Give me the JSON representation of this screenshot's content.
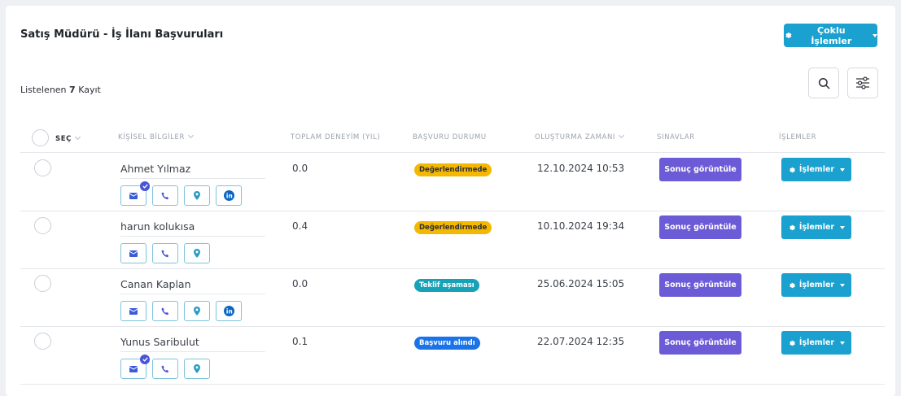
{
  "page": {
    "title": "Satış Müdürü - İş İlanı Başvuruları",
    "bulk_button": "Çoklu İşlemler",
    "count_prefix": "Listelenen",
    "count_value": "7",
    "count_suffix": "Kayıt",
    "search_icon": "search-icon",
    "filter_icon": "filter-sliders-icon"
  },
  "table": {
    "headers": {
      "select": "SEÇ",
      "personal": "KİŞİSEL BİLGİLER",
      "experience": "TOPLAM DENEYİM (YIL)",
      "status": "BAŞVURU DURUMU",
      "created": "OLUŞTURMA ZAMANI",
      "exams": "SINAVLAR",
      "actions": "İŞLEMLER"
    },
    "rows": [
      {
        "name": "Ahmet Yılmaz",
        "experience": "0.0",
        "status": "Değerlendirmede",
        "status_color": "#f5b800",
        "created": "12.10.2024 10:53",
        "exam_button": "Sonuç görüntüle",
        "action_button": "İşlemler"
      },
      {
        "name": "harun kolukısa",
        "experience": "0.4",
        "status": "Değerlendirmede",
        "status_color": "#f5b800",
        "created": "10.10.2024 19:34",
        "exam_button": "Sonuç görüntüle",
        "action_button": "İşlemler"
      },
      {
        "name": "Canan Kaplan",
        "experience": "0.0",
        "status": "Teklif aşaması",
        "status_color": "#17a2b8",
        "created": "25.06.2024 15:05",
        "exam_button": "Sonuç görüntüle",
        "action_button": "İşlemler"
      },
      {
        "name": "Yunus Saribulut",
        "experience": "0.1",
        "status": "Başvuru alındı",
        "status_color": "#1a73e8",
        "created": "22.07.2024 12:35",
        "exam_button": "Sonuç görüntüle",
        "action_button": "İşlemler"
      }
    ]
  },
  "colors": {
    "primary": "#1ba1cf",
    "exam_button": "#6c5bd6",
    "verified_badge": "#4a55d6"
  }
}
